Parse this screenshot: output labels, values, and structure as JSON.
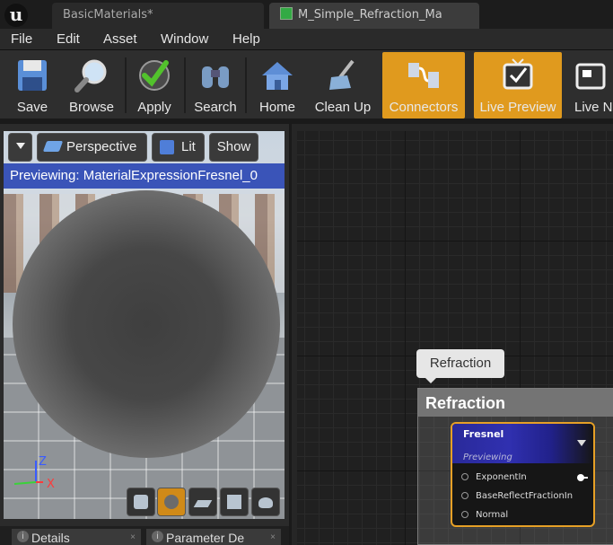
{
  "title_bar": {
    "logo_icon": "unreal-engine-logo-icon",
    "tabs": [
      {
        "label": "BasicMaterials*",
        "active": false
      },
      {
        "label": "M_Simple_Refraction_Ma",
        "active": true
      }
    ]
  },
  "menu": {
    "items": [
      "File",
      "Edit",
      "Asset",
      "Window",
      "Help"
    ]
  },
  "toolbar": {
    "buttons": [
      {
        "label": "Save",
        "icon": "floppy-disk-icon",
        "active": false
      },
      {
        "label": "Browse",
        "icon": "magnifier-icon",
        "active": false
      },
      {
        "label": "Apply",
        "icon": "checkmark-icon",
        "active": false
      },
      {
        "label": "Search",
        "icon": "binoculars-icon",
        "active": false
      },
      {
        "label": "Home",
        "icon": "house-icon",
        "active": false
      },
      {
        "label": "Clean Up",
        "icon": "broom-icon",
        "active": false
      },
      {
        "label": "Connectors",
        "icon": "connectors-icon",
        "active": true
      },
      {
        "label": "Live Preview",
        "icon": "tv-check-icon",
        "active": true
      },
      {
        "label": "Live N",
        "icon": "tv-node-icon",
        "active": false
      }
    ],
    "accent_color": "#e09a1e"
  },
  "viewport": {
    "dropdown_icon": "chevron-down-icon",
    "perspective_label": "Perspective",
    "lit_label": "Lit",
    "show_label": "Show",
    "previewing_text": "Previewing: MaterialExpressionFresnel_0",
    "axis_labels": {
      "z": "Z",
      "x": "X"
    },
    "preview_shapes": [
      {
        "icon": "cylinder-icon",
        "selected": false
      },
      {
        "icon": "sphere-icon",
        "selected": true
      },
      {
        "icon": "plane-icon",
        "selected": false
      },
      {
        "icon": "cube-icon",
        "selected": false
      },
      {
        "icon": "teapot-icon",
        "selected": false
      }
    ]
  },
  "bottom_tabs": [
    {
      "label": "Details"
    },
    {
      "label": "Parameter De"
    }
  ],
  "graph": {
    "comment_bubble": "Refraction",
    "comment_title": "Refraction",
    "node": {
      "title": "Fresnel",
      "subtitle": "Previewing",
      "inputs": [
        "ExponentIn",
        "BaseReflectFractionIn",
        "Normal"
      ]
    }
  }
}
